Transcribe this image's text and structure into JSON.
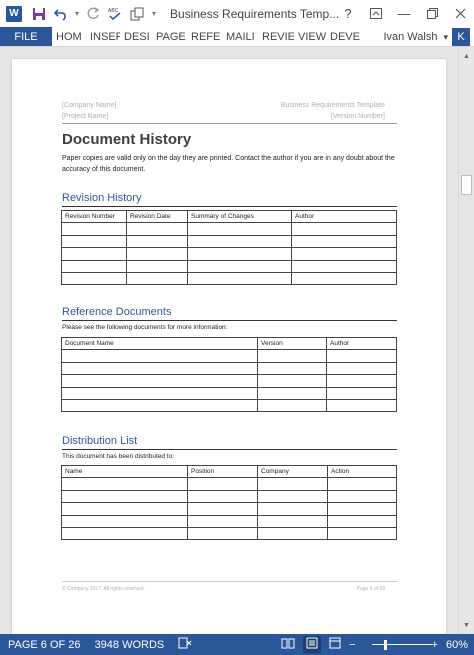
{
  "titlebar": {
    "app_icon_letter": "W",
    "document_title": "Business Requirements Temp...",
    "help_label": "?",
    "minimize_label": "—"
  },
  "ribbon": {
    "file_label": "FILE",
    "tabs": [
      "HOM",
      "INSER",
      "DESI",
      "PAGE",
      "REFE",
      "MAILI",
      "REVIE",
      "VIEW",
      "DEVE"
    ],
    "user_name": "Ivan Walsh",
    "avatar_letter": "K"
  },
  "page": {
    "header": {
      "company_name": "[Company Name]",
      "project_name": "[Project Name]",
      "template_name": "Business Requirements Template",
      "version_number": "[Version Number]"
    },
    "title": "Document History",
    "intro": "Paper copies are valid only on the day they are printed. Contact the author if you are in any doubt about the accuracy of this document.",
    "revision": {
      "heading": "Revision History",
      "columns": [
        "Revision Number",
        "Revision Date",
        "Summary of Changes",
        "Author"
      ]
    },
    "reference": {
      "heading": "Reference Documents",
      "note": "Please see the following documents for more information:",
      "columns": [
        "Document Name",
        "Version",
        "Author"
      ]
    },
    "distribution": {
      "heading": "Distribution List",
      "note": "This document has been distributed to:",
      "columns": [
        "Name",
        "Position",
        "Company",
        "Action"
      ]
    },
    "footer": {
      "copyright": "© Company 2017. All rights reserved.",
      "page_of": "Page 6 of 26"
    }
  },
  "status": {
    "page": "PAGE 6 OF 26",
    "words": "3948 WORDS",
    "zoom": "60%",
    "zoom_minus": "−",
    "zoom_plus": "+"
  }
}
